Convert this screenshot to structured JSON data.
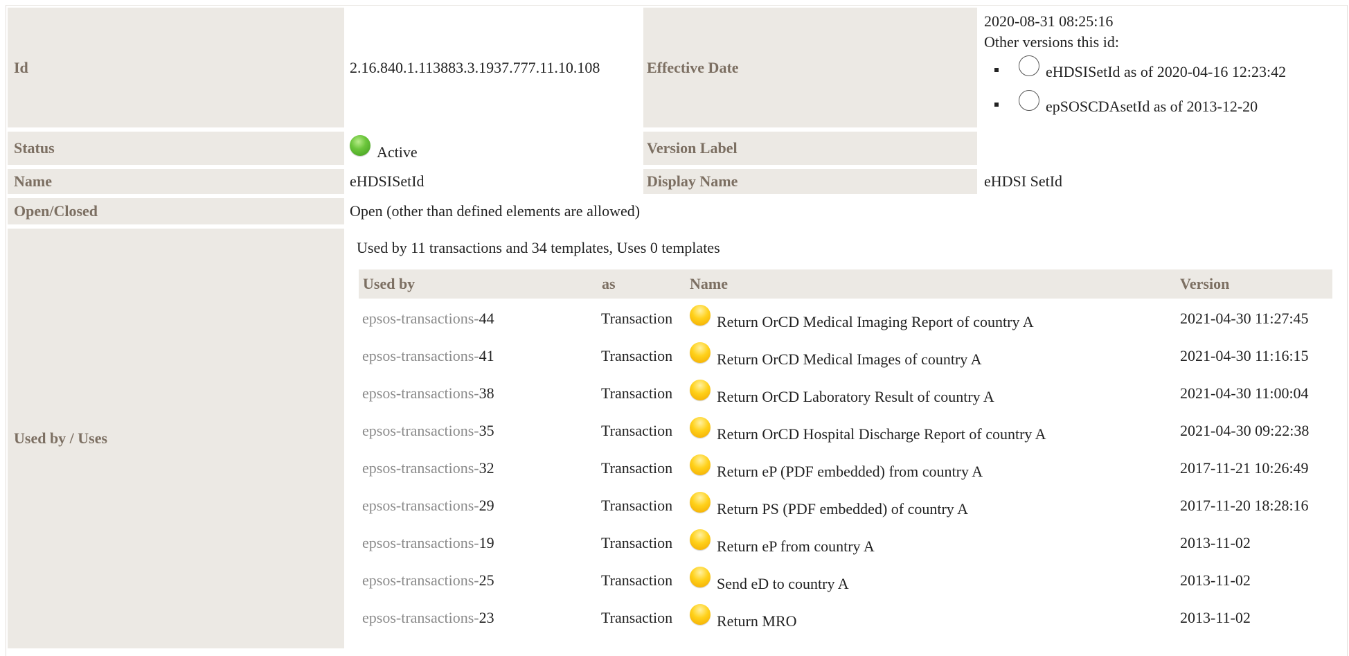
{
  "meta": {
    "id_label": "Id",
    "id_value": "2.16.840.1.113883.3.1937.777.11.10.108",
    "effective_date_label": "Effective Date",
    "effective_date_value": "2020-08-31 08:25:16",
    "other_versions_label": "Other versions this id:",
    "other_versions": [
      {
        "text": "eHDSISetId as of 2020-04-16 12:23:42"
      },
      {
        "text": "epSOSCDAsetId as of 2013-12-20"
      }
    ],
    "status_label": "Status",
    "status_value": "Active",
    "version_label_label": "Version Label",
    "name_label": "Name",
    "name_value": "eHDSISetId",
    "display_name_label": "Display Name",
    "display_name_value": "eHDSI SetId",
    "open_closed_label": "Open/Closed",
    "open_closed_value": "Open (other than defined elements are allowed)",
    "used_by_uses_label": "Used by / Uses",
    "colors": {
      "label_bg": "#ece9e4",
      "label_text": "#7c6f62",
      "link_gray": "#8a8a8a",
      "active_green": "#5cb82e",
      "draft_yellow": "#ffcc00"
    }
  },
  "usage": {
    "summary": "Used by 11 transactions and 34 templates, Uses 0 templates",
    "columns": {
      "used_by": "Used by",
      "as": "as",
      "name": "Name",
      "version": "Version"
    },
    "rows": [
      {
        "prefix": "epsos-transactions-",
        "num": "44",
        "as": "Transaction",
        "name": "Return OrCD Medical Imaging Report of country A",
        "version": "2021-04-30 11:27:45"
      },
      {
        "prefix": "epsos-transactions-",
        "num": "41",
        "as": "Transaction",
        "name": "Return OrCD Medical Images of country A",
        "version": "2021-04-30 11:16:15"
      },
      {
        "prefix": "epsos-transactions-",
        "num": "38",
        "as": "Transaction",
        "name": "Return OrCD Laboratory Result of country A",
        "version": "2021-04-30 11:00:04"
      },
      {
        "prefix": "epsos-transactions-",
        "num": "35",
        "as": "Transaction",
        "name": "Return OrCD Hospital Discharge Report of country A",
        "version": "2021-04-30 09:22:38"
      },
      {
        "prefix": "epsos-transactions-",
        "num": "32",
        "as": "Transaction",
        "name": "Return eP (PDF embedded) from country A",
        "version": "2017-11-21 10:26:49"
      },
      {
        "prefix": "epsos-transactions-",
        "num": "29",
        "as": "Transaction",
        "name": "Return PS (PDF embedded) of country A",
        "version": "2017-11-20 18:28:16"
      },
      {
        "prefix": "epsos-transactions-",
        "num": "19",
        "as": "Transaction",
        "name": "Return eP from country A",
        "version": "2013-11-02"
      },
      {
        "prefix": "epsos-transactions-",
        "num": "25",
        "as": "Transaction",
        "name": "Send eD to country A",
        "version": "2013-11-02"
      },
      {
        "prefix": "epsos-transactions-",
        "num": "23",
        "as": "Transaction",
        "name": "Return MRO",
        "version": "2013-11-02"
      }
    ]
  }
}
